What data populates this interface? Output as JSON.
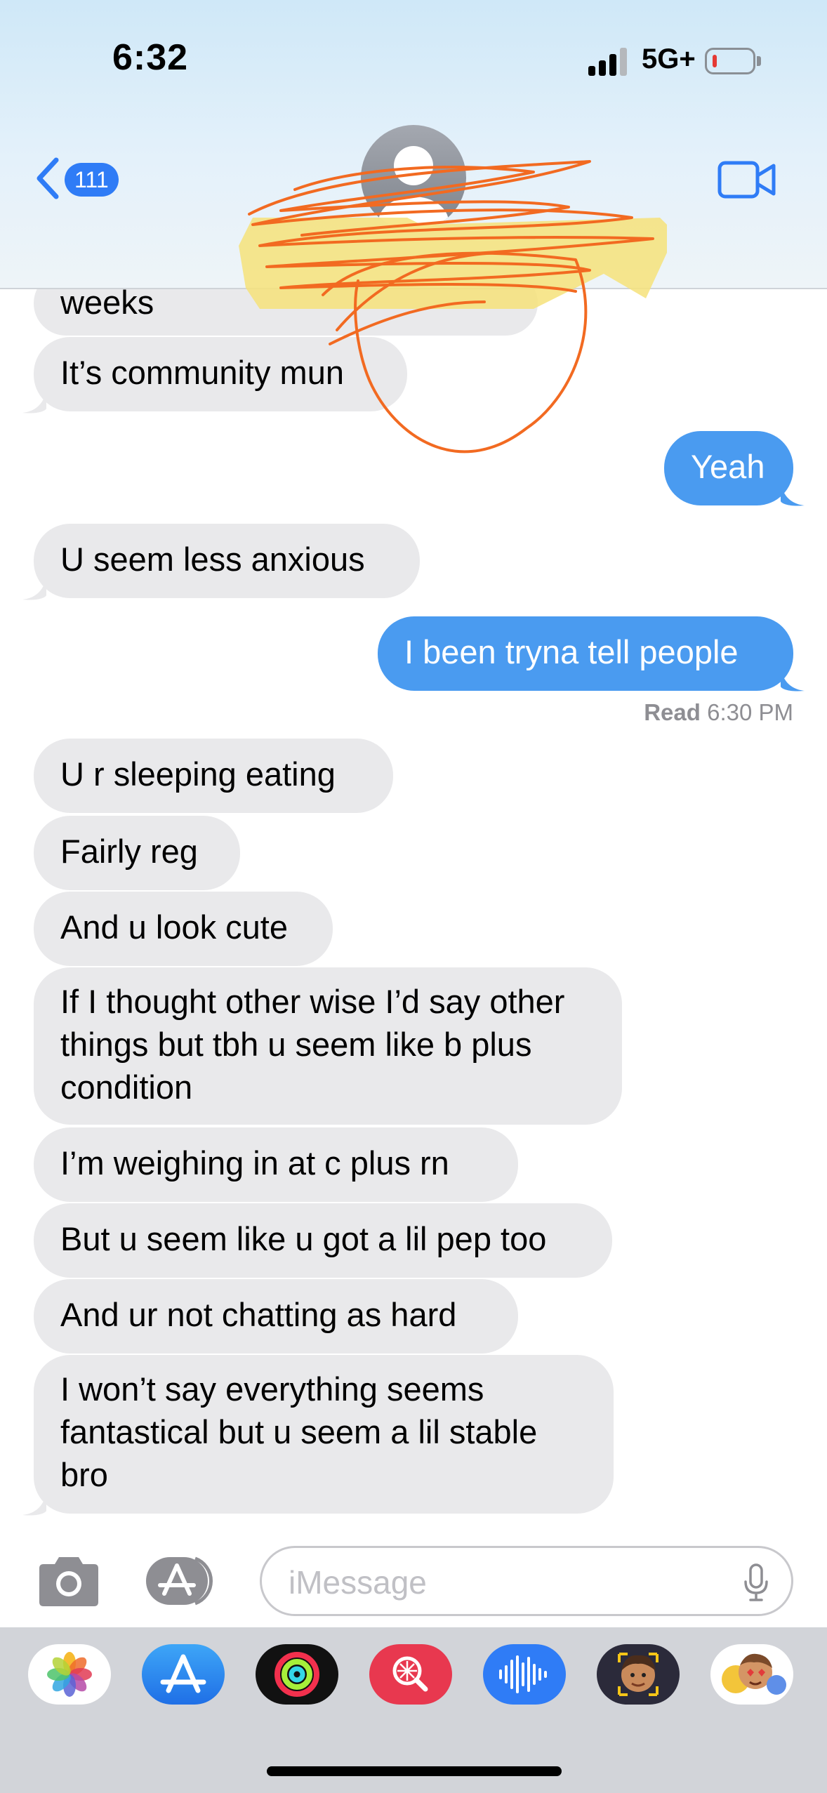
{
  "status_bar": {
    "time": "6:32",
    "network": "5G+"
  },
  "header": {
    "back_count": "111"
  },
  "messages": [
    {
      "side": "received",
      "text": "weeks"
    },
    {
      "side": "received",
      "text": "It’s community mun"
    },
    {
      "side": "sent",
      "text": "Yeah"
    },
    {
      "side": "received",
      "text": "U seem less anxious"
    },
    {
      "side": "sent",
      "text": "I been tryna tell people"
    },
    {
      "side": "received",
      "text": "U r sleeping eating"
    },
    {
      "side": "received",
      "text": "Fairly reg"
    },
    {
      "side": "received",
      "text": "And u look cute"
    },
    {
      "side": "received",
      "text": "If I thought other wise I’d say other things but tbh u seem like b plus condition"
    },
    {
      "side": "received",
      "text": "I’m weighing in at c plus rn"
    },
    {
      "side": "received",
      "text": "But u seem like u got a lil pep too"
    },
    {
      "side": "received",
      "text": "And ur not chatting as hard"
    },
    {
      "side": "received",
      "text": "I won’t say everything seems fantastical but u seem a lil stable bro"
    }
  ],
  "read_receipt": {
    "label": "Read",
    "time": "6:30 PM"
  },
  "composer": {
    "placeholder": "iMessage"
  },
  "app_drawer": [
    "photos-icon",
    "app-store-icon",
    "activity-icon",
    "image-search-icon",
    "audio-message-icon",
    "memoji-icon",
    "animoji-stickers-icon"
  ],
  "colors": {
    "sent_bubble": "#4a9bf0",
    "received_bubble": "#e9e9eb",
    "accent": "#2f7cf6",
    "scribble": "#f26a21"
  }
}
